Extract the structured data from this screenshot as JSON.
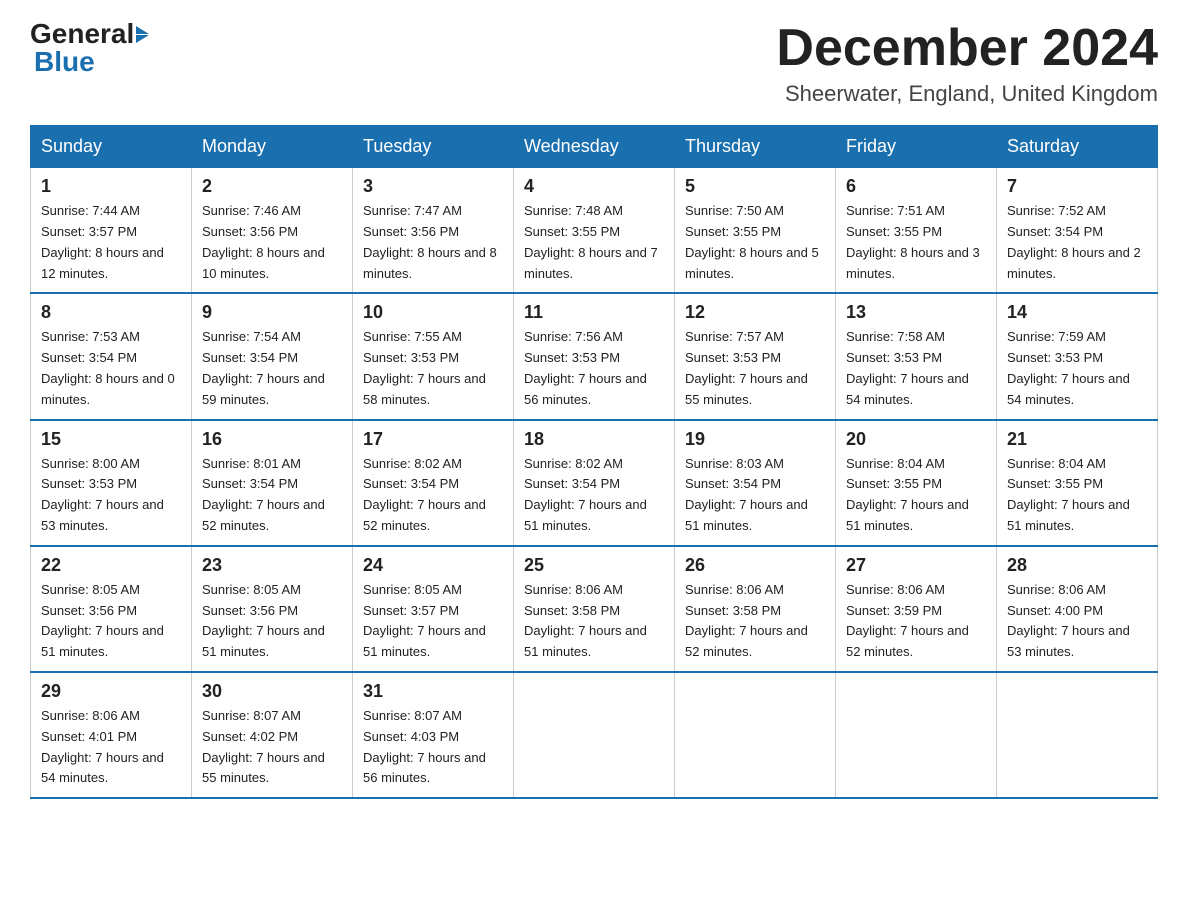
{
  "header": {
    "logo_general": "General",
    "logo_blue": "Blue",
    "month_title": "December 2024",
    "subtitle": "Sheerwater, England, United Kingdom"
  },
  "columns": [
    "Sunday",
    "Monday",
    "Tuesday",
    "Wednesday",
    "Thursday",
    "Friday",
    "Saturday"
  ],
  "weeks": [
    [
      {
        "day": "1",
        "sunrise": "7:44 AM",
        "sunset": "3:57 PM",
        "daylight": "8 hours and 12 minutes."
      },
      {
        "day": "2",
        "sunrise": "7:46 AM",
        "sunset": "3:56 PM",
        "daylight": "8 hours and 10 minutes."
      },
      {
        "day": "3",
        "sunrise": "7:47 AM",
        "sunset": "3:56 PM",
        "daylight": "8 hours and 8 minutes."
      },
      {
        "day": "4",
        "sunrise": "7:48 AM",
        "sunset": "3:55 PM",
        "daylight": "8 hours and 7 minutes."
      },
      {
        "day": "5",
        "sunrise": "7:50 AM",
        "sunset": "3:55 PM",
        "daylight": "8 hours and 5 minutes."
      },
      {
        "day": "6",
        "sunrise": "7:51 AM",
        "sunset": "3:55 PM",
        "daylight": "8 hours and 3 minutes."
      },
      {
        "day": "7",
        "sunrise": "7:52 AM",
        "sunset": "3:54 PM",
        "daylight": "8 hours and 2 minutes."
      }
    ],
    [
      {
        "day": "8",
        "sunrise": "7:53 AM",
        "sunset": "3:54 PM",
        "daylight": "8 hours and 0 minutes."
      },
      {
        "day": "9",
        "sunrise": "7:54 AM",
        "sunset": "3:54 PM",
        "daylight": "7 hours and 59 minutes."
      },
      {
        "day": "10",
        "sunrise": "7:55 AM",
        "sunset": "3:53 PM",
        "daylight": "7 hours and 58 minutes."
      },
      {
        "day": "11",
        "sunrise": "7:56 AM",
        "sunset": "3:53 PM",
        "daylight": "7 hours and 56 minutes."
      },
      {
        "day": "12",
        "sunrise": "7:57 AM",
        "sunset": "3:53 PM",
        "daylight": "7 hours and 55 minutes."
      },
      {
        "day": "13",
        "sunrise": "7:58 AM",
        "sunset": "3:53 PM",
        "daylight": "7 hours and 54 minutes."
      },
      {
        "day": "14",
        "sunrise": "7:59 AM",
        "sunset": "3:53 PM",
        "daylight": "7 hours and 54 minutes."
      }
    ],
    [
      {
        "day": "15",
        "sunrise": "8:00 AM",
        "sunset": "3:53 PM",
        "daylight": "7 hours and 53 minutes."
      },
      {
        "day": "16",
        "sunrise": "8:01 AM",
        "sunset": "3:54 PM",
        "daylight": "7 hours and 52 minutes."
      },
      {
        "day": "17",
        "sunrise": "8:02 AM",
        "sunset": "3:54 PM",
        "daylight": "7 hours and 52 minutes."
      },
      {
        "day": "18",
        "sunrise": "8:02 AM",
        "sunset": "3:54 PM",
        "daylight": "7 hours and 51 minutes."
      },
      {
        "day": "19",
        "sunrise": "8:03 AM",
        "sunset": "3:54 PM",
        "daylight": "7 hours and 51 minutes."
      },
      {
        "day": "20",
        "sunrise": "8:04 AM",
        "sunset": "3:55 PM",
        "daylight": "7 hours and 51 minutes."
      },
      {
        "day": "21",
        "sunrise": "8:04 AM",
        "sunset": "3:55 PM",
        "daylight": "7 hours and 51 minutes."
      }
    ],
    [
      {
        "day": "22",
        "sunrise": "8:05 AM",
        "sunset": "3:56 PM",
        "daylight": "7 hours and 51 minutes."
      },
      {
        "day": "23",
        "sunrise": "8:05 AM",
        "sunset": "3:56 PM",
        "daylight": "7 hours and 51 minutes."
      },
      {
        "day": "24",
        "sunrise": "8:05 AM",
        "sunset": "3:57 PM",
        "daylight": "7 hours and 51 minutes."
      },
      {
        "day": "25",
        "sunrise": "8:06 AM",
        "sunset": "3:58 PM",
        "daylight": "7 hours and 51 minutes."
      },
      {
        "day": "26",
        "sunrise": "8:06 AM",
        "sunset": "3:58 PM",
        "daylight": "7 hours and 52 minutes."
      },
      {
        "day": "27",
        "sunrise": "8:06 AM",
        "sunset": "3:59 PM",
        "daylight": "7 hours and 52 minutes."
      },
      {
        "day": "28",
        "sunrise": "8:06 AM",
        "sunset": "4:00 PM",
        "daylight": "7 hours and 53 minutes."
      }
    ],
    [
      {
        "day": "29",
        "sunrise": "8:06 AM",
        "sunset": "4:01 PM",
        "daylight": "7 hours and 54 minutes."
      },
      {
        "day": "30",
        "sunrise": "8:07 AM",
        "sunset": "4:02 PM",
        "daylight": "7 hours and 55 minutes."
      },
      {
        "day": "31",
        "sunrise": "8:07 AM",
        "sunset": "4:03 PM",
        "daylight": "7 hours and 56 minutes."
      },
      null,
      null,
      null,
      null
    ]
  ],
  "labels": {
    "sunrise": "Sunrise:",
    "sunset": "Sunset:",
    "daylight": "Daylight:"
  }
}
